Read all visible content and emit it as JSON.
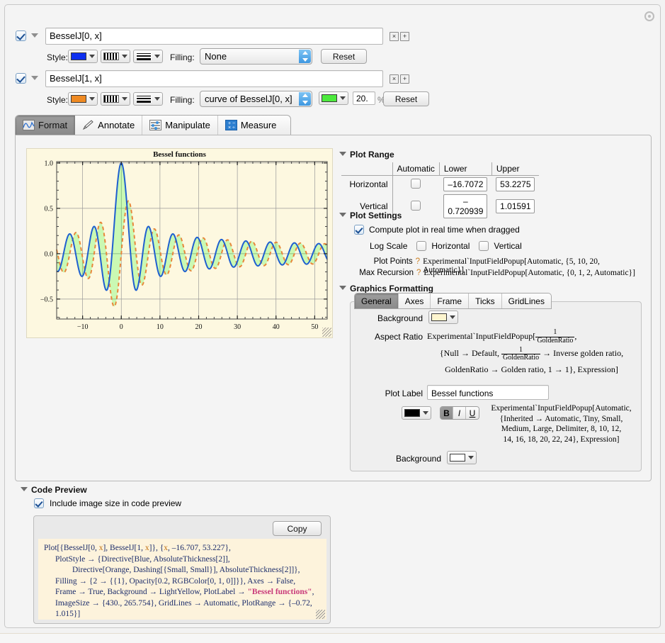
{
  "window": {
    "gear_icon": "gear-icon"
  },
  "functions": [
    {
      "enabled": true,
      "expression": "BesselJ[0, x]",
      "style_label": "Style:",
      "color": "#0d2ff0",
      "filling_label": "Filling:",
      "filling_value": "None",
      "reset_label": "Reset",
      "remove_label": "×",
      "add_label": "+"
    },
    {
      "enabled": true,
      "expression": "BesselJ[1, x]",
      "style_label": "Style:",
      "color": "#ef8a22",
      "filling_label": "Filling:",
      "filling_value": "curve of BesselJ[0, x]",
      "fill_color": "#4cea3c",
      "opacity_value": "20.",
      "opacity_unit": "%",
      "reset_label": "Reset",
      "remove_label": "×",
      "add_label": "+"
    }
  ],
  "tabs": [
    {
      "label": "Format",
      "icon": "waveform-icon",
      "active": true
    },
    {
      "label": "Annotate",
      "icon": "pencil-icon",
      "active": false
    },
    {
      "label": "Manipulate",
      "icon": "sliders-icon",
      "active": false
    },
    {
      "label": "Measure",
      "icon": "calculator-icon",
      "active": false
    }
  ],
  "chart_data": {
    "type": "line",
    "title": "Bessel functions",
    "xlabel": "",
    "ylabel": "",
    "xlim": [
      -16.707,
      53.227
    ],
    "ylim": [
      -0.72,
      1.015
    ],
    "xticks": [
      -10,
      0,
      10,
      20,
      30,
      40,
      50
    ],
    "yticks": [
      -0.5,
      0.0,
      0.5,
      1.0
    ],
    "xtick_labels": [
      "-10",
      "0",
      "10",
      "20",
      "30",
      "40",
      "50"
    ],
    "ytick_labels": [
      "-0.5",
      "0.0",
      "0.5",
      "1.0"
    ],
    "grid": true,
    "frame": true,
    "background": "#fdf8e0",
    "fill_between": {
      "series": [
        "BesselJ[1, x]",
        "BesselJ[0, x]"
      ],
      "color": "#00ff00",
      "opacity": 0.2
    },
    "series": [
      {
        "name": "BesselJ[0, x]",
        "color": "#1f5fd0",
        "style": "solid",
        "thickness": 2
      },
      {
        "name": "BesselJ[1, x]",
        "color": "#e8873a",
        "style": "dashed",
        "thickness": 2
      }
    ]
  },
  "plot_range": {
    "section_title": "Plot Range",
    "columns": [
      "",
      "Automatic",
      "Lower",
      "Upper"
    ],
    "rows": [
      {
        "label": "Horizontal",
        "automatic": false,
        "lower": "–16.7072",
        "upper": "53.2275"
      },
      {
        "label": "Vertical",
        "automatic": false,
        "lower": "–0.720939",
        "upper": "1.01591"
      }
    ]
  },
  "plot_settings": {
    "section_title": "Plot Settings",
    "realtime_label": "Compute plot in real time when dragged",
    "realtime_checked": true,
    "logscale_label": "Log Scale",
    "logscale_horizontal": "Horizontal",
    "logscale_vertical": "Vertical",
    "logscale_h_checked": false,
    "logscale_v_checked": false,
    "plot_points_label": "Plot Points",
    "plot_points_help": "?",
    "plot_points_value": "Experimental`InputFieldPopup[Automatic, {5, 10, 20, Automatic}]",
    "max_recursion_label": "Max Recursion",
    "max_recursion_help": "?",
    "max_recursion_value": "Experimental`InputFieldPopup[Automatic, {0, 1, 2, Automatic}]"
  },
  "graphics_formatting": {
    "section_title": "Graphics Formatting",
    "tabs": [
      "General",
      "Axes",
      "Frame",
      "Ticks",
      "GridLines"
    ],
    "active_tab": "General",
    "background_label": "Background",
    "background_color": "#fdf5cf",
    "aspect_ratio_label": "Aspect Ratio",
    "aspect_ratio_prefix": "Experimental`InputFieldPopup[",
    "aspect_ratio_frac_num": "1",
    "aspect_ratio_frac_den": "GoldenRatio",
    "aspect_ratio_line2_a": "{Null → Default,",
    "aspect_ratio_line2_b": "→ Inverse golden ratio,",
    "aspect_ratio_line3": "GoldenRatio → Golden ratio, 1 → 1}, Expression]",
    "plot_label_label": "Plot Label",
    "plot_label_value": "Bessel functions",
    "font_color": "#000000",
    "bold_label": "B",
    "italic_label": "I",
    "underline_label": "U",
    "bold_active": true,
    "font_popup_line1": "Experimental`InputFieldPopup[Automatic,",
    "font_popup_line2": "{Inherited → Automatic, Tiny, Small,",
    "font_popup_line3": "Medium, Large, Delimiter, 8, 10, 12,",
    "font_popup_line4": "14, 16, 18, 20, 22, 24}, Expression]",
    "label_background_label": "Background",
    "label_background_color": "#ffffff"
  },
  "code_preview": {
    "section_title": "Code Preview",
    "include_image_size_label": "Include image size in code preview",
    "include_image_size_checked": true,
    "copy_label": "Copy",
    "code_lines": [
      "Plot[{BesselJ[0, x], BesselJ[1, x]}, {x, –16.707, 53.227},",
      "   PlotStyle → {Directive[Blue, AbsoluteThickness[2]],",
      "      Directive[Orange, Dashing[{Small, Small}], AbsoluteThickness[2]]},",
      "   Filling → {2 → {{1}, Opacity[0.2, RGBColor[0, 1, 0]]}}, Axes → False,",
      "   Frame → True, Background → LightYellow, PlotLabel → \"Bessel functions\",",
      "   ImageSize → {430., 265.754}, GridLines → Automatic, PlotRange → {–0.72, 1.015}]"
    ]
  }
}
